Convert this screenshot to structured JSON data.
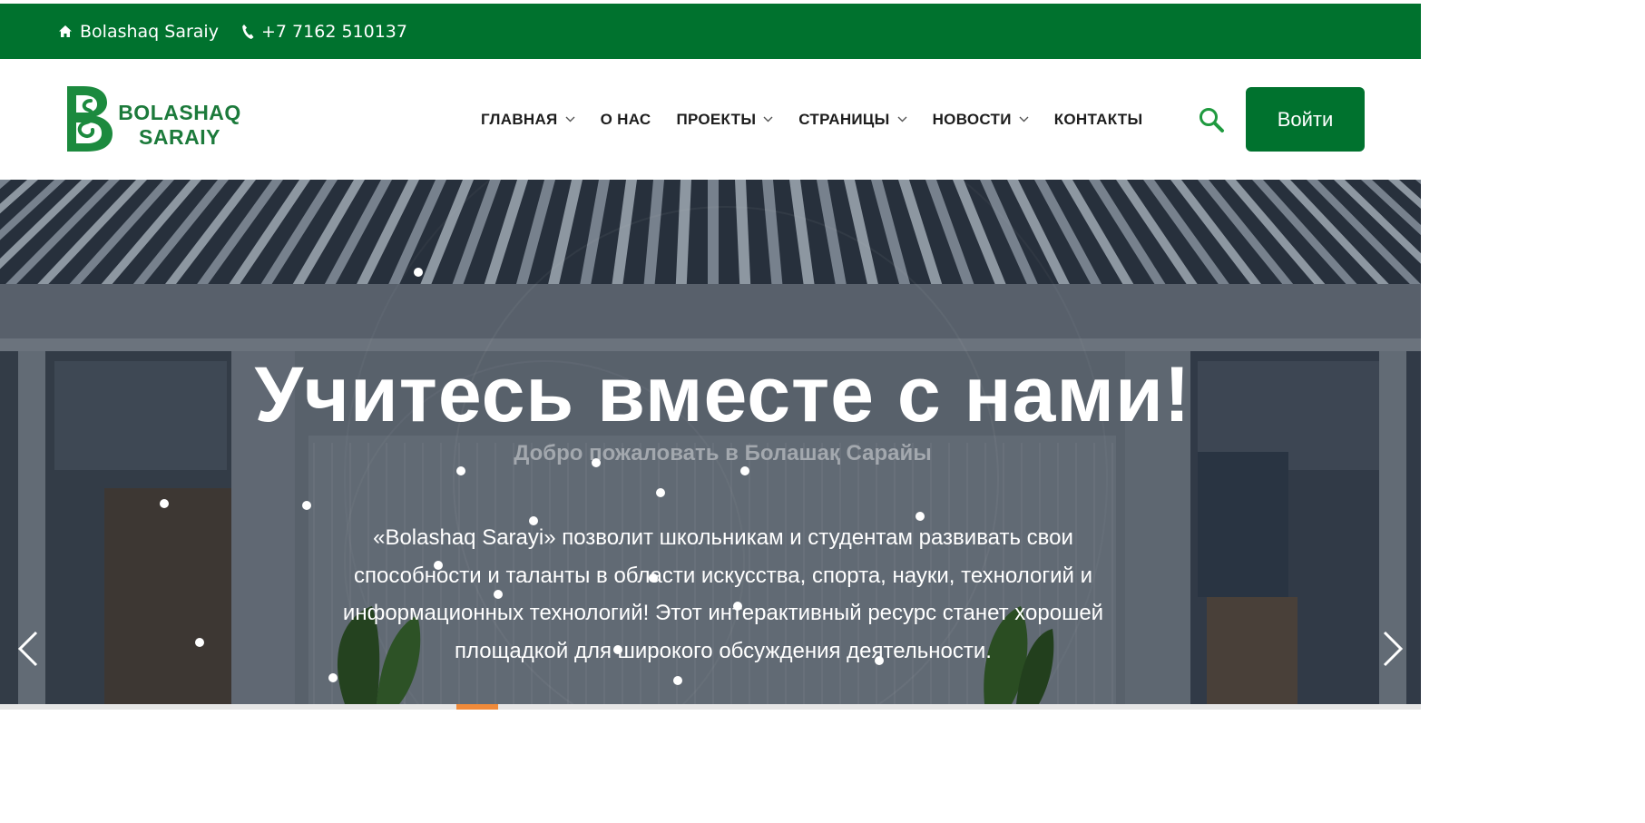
{
  "topbar": {
    "site_name": "Bolashaq Saraiy",
    "phone": "+7 7162 510137",
    "icons": [
      "home-icon",
      "phone-icon"
    ]
  },
  "header": {
    "logo_line1": "BOLASHAQ",
    "logo_line2": "SARAIY",
    "nav": [
      {
        "label": "ГЛАВНАЯ",
        "has_dropdown": true
      },
      {
        "label": "О НАС",
        "has_dropdown": false
      },
      {
        "label": "ПРОЕКТЫ",
        "has_dropdown": true
      },
      {
        "label": "СТРАНИЦЫ",
        "has_dropdown": true
      },
      {
        "label": "НОВОСТИ",
        "has_dropdown": true
      },
      {
        "label": "КОНТАКТЫ",
        "has_dropdown": false
      }
    ],
    "login_label": "Войти"
  },
  "hero": {
    "title": "Учитесь вместе с нами!",
    "subtitle": "Добро пожаловать в Болашақ Сарайы",
    "description": "«Bolashaq Sarayi» позволит школьникам и студентам развивать свои способности и таланты в области искусства, спорта, науки, технологий и информационных технологий! Этот интерактивный ресурс станет хорошей площадкой для широкого обсуждения деятельности.",
    "prev_icon": "chevron-left-icon",
    "next_icon": "chevron-right-icon"
  },
  "colors": {
    "brand_green": "#00722e",
    "logo_green": "#1c7a3b",
    "search_icon": "#1f9a3f",
    "accent_orange": "#f08a3a"
  }
}
